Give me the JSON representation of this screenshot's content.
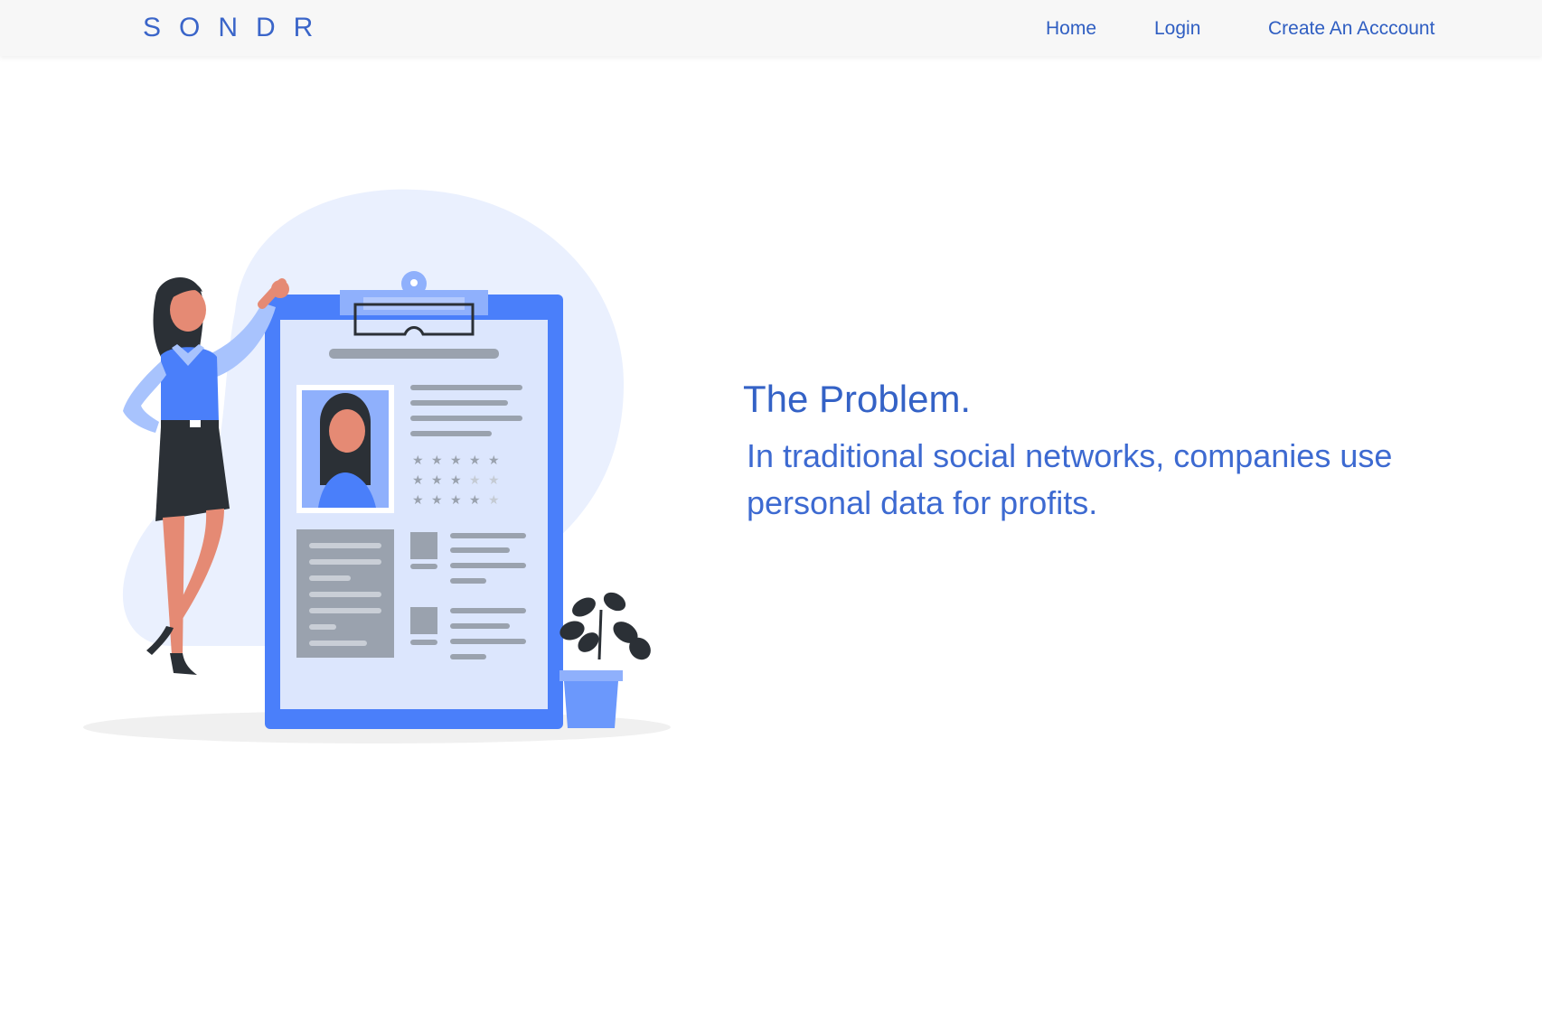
{
  "navbar": {
    "brand": "SONDR",
    "links": [
      {
        "label": "Home"
      },
      {
        "label": "Login"
      },
      {
        "label": "Create An Acccount"
      }
    ]
  },
  "hero": {
    "title": "The Problem.",
    "description": "In traditional social networks, companies use personal data for profits."
  },
  "colors": {
    "brand_blue": "#3a65c9",
    "clipboard_blue": "#4a7ffa",
    "light_blob": "#eaf0fe"
  },
  "illustration": {
    "subject": "woman-leaning-on-resume-clipboard",
    "star_rows": [
      5,
      3,
      4
    ]
  }
}
